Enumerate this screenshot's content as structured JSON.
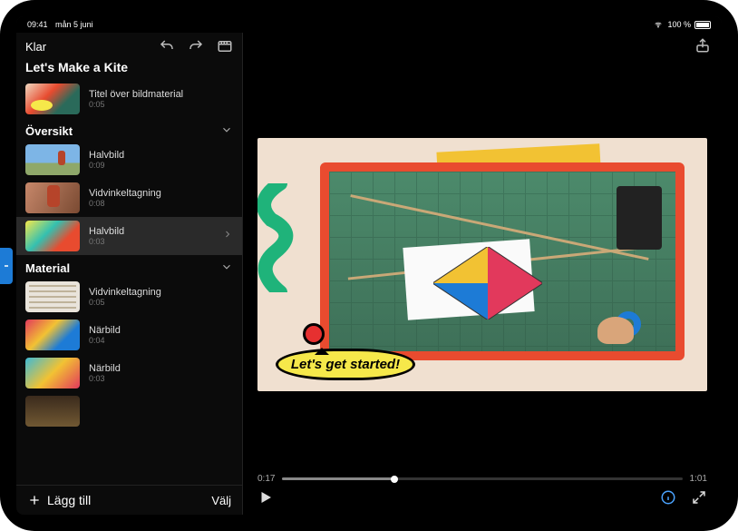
{
  "statusbar": {
    "time": "09:41",
    "date": "mån 5 juni",
    "battery": "100 %"
  },
  "toolbar": {
    "done": "Klar"
  },
  "project": {
    "title": "Let's Make a Kite"
  },
  "title_clip": {
    "label": "Titel över bildmaterial",
    "dur": "0:05"
  },
  "sections": {
    "oversikt": {
      "heading": "Översikt"
    },
    "material": {
      "heading": "Material"
    }
  },
  "clips": {
    "ov1": {
      "label": "Halvbild",
      "dur": "0:09"
    },
    "ov2": {
      "label": "Vidvinkeltagning",
      "dur": "0:08"
    },
    "ov3": {
      "label": "Halvbild",
      "dur": "0:03"
    },
    "ma1": {
      "label": "Vidvinkeltagning",
      "dur": "0:05"
    },
    "ma2": {
      "label": "Närbild",
      "dur": "0:04"
    },
    "ma3": {
      "label": "Närbild",
      "dur": "0:03"
    }
  },
  "bottom": {
    "add": "Lägg till",
    "select": "Välj"
  },
  "player": {
    "current": "0:17",
    "total": "1:01",
    "bubble": "Let's get started!"
  }
}
